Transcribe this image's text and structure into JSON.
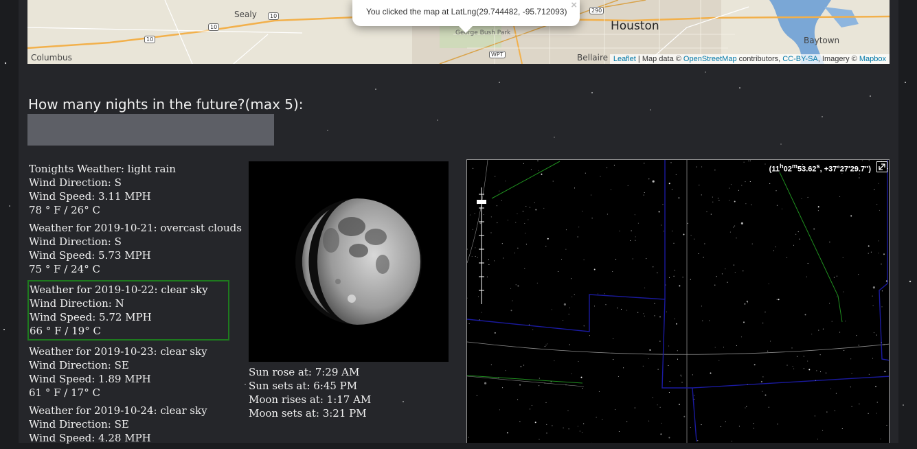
{
  "map": {
    "labels": {
      "houston": "Houston",
      "sealy": "Sealy",
      "columbus": "Columbus",
      "bellaire": "Bellaire",
      "baytown": "Baytown",
      "park": "George Bush Park"
    },
    "shields": [
      "10",
      "10",
      "10",
      "290",
      "WPT"
    ],
    "popup": {
      "text": "You clicked the map at LatLng(29.744482, -95.712093)",
      "close": "×"
    },
    "attribution": {
      "leaflet": "Leaflet",
      "sep": " | Map data © ",
      "osm": "OpenStreetMap",
      "contrib": " contributors, ",
      "license": "CC-BY-SA",
      "imagery": ", Imagery © ",
      "mapbox": "Mapbox"
    }
  },
  "form": {
    "nights_label": "How many nights in the future?(max 5):",
    "nights_value": ""
  },
  "weather": [
    {
      "title": "Tonights Weather: light rain",
      "wind_dir": "Wind Direction: S",
      "wind_speed": "Wind Speed: 3.11 MPH",
      "temp": "78 ° F / 26° C"
    },
    {
      "title": "Weather for 2019-10-21: overcast clouds",
      "wind_dir": "Wind Direction: S",
      "wind_speed": "Wind Speed: 5.73 MPH",
      "temp": "75 ° F / 24° C"
    },
    {
      "title": "Weather for 2019-10-22: clear sky",
      "wind_dir": "Wind Direction: N",
      "wind_speed": "Wind Speed: 5.72 MPH",
      "temp": "66 ° F / 19° C"
    },
    {
      "title": "Weather for 2019-10-23: clear sky",
      "wind_dir": "Wind Direction: SE",
      "wind_speed": "Wind Speed: 1.89 MPH",
      "temp": "61 ° F / 17° C"
    },
    {
      "title": "Weather for 2019-10-24: clear sky",
      "wind_dir": "Wind Direction: SE",
      "wind_speed": "Wind Speed: 4.28 MPH",
      "temp": ""
    }
  ],
  "selected_weather_index": 2,
  "sun_moon": {
    "sunrise": "Sun rose at: 7:29 AM",
    "sunset": "Sun sets at: 6:45 PM",
    "moonrise": "Moon rises at: 1:17 AM",
    "moonset": "Moon sets at: 3:21 PM"
  },
  "sky": {
    "coord_ra_h": "11",
    "coord_ra_m": "02",
    "coord_ra_s": "53.62",
    "coord_dec": ", +37°27′29.7″)",
    "colors": {
      "constellation_lines": "#1f8f1f",
      "boundaries": "#1a1aa0",
      "grid": "#8c8c8c"
    }
  },
  "colors": {
    "panel_bg": "#25262a",
    "page_bg": "#1b1c1f",
    "input_bg": "#5d5f66",
    "selected_border": "#1e7a1e",
    "link": "#0078a8"
  }
}
